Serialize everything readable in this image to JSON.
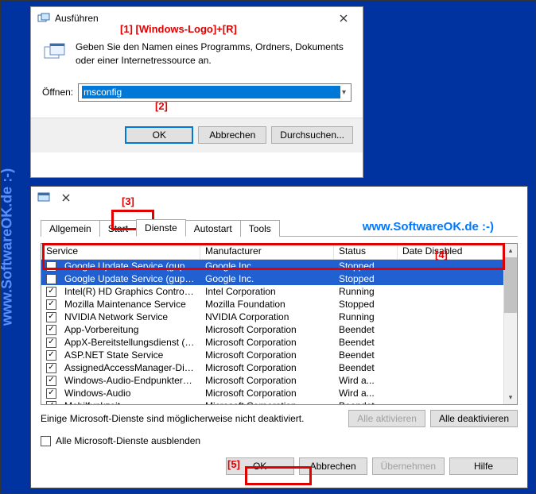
{
  "watermark_left": "www.SoftwareOK.de :-)",
  "annotations": {
    "a1": "[1]   [Windows-Logo]+[R]",
    "a2": "[2]",
    "a3": "[3]",
    "a4": "[4]",
    "a5": "[5]"
  },
  "run": {
    "title": "Ausführen",
    "description": "Geben Sie den Namen eines Programms, Ordners, Dokuments oder einer Internetressource an.",
    "open_label": "Öffnen:",
    "value": "msconfig",
    "ok": "OK",
    "cancel": "Abbrechen",
    "browse": "Durchsuchen..."
  },
  "msconfig": {
    "tabs": [
      "Allgemein",
      "Start",
      "Dienste",
      "Autostart",
      "Tools"
    ],
    "active_tab": 2,
    "watermark_tab": "www.SoftwareOK.de :-)",
    "columns": {
      "service": "Service",
      "manufacturer": "Manufacturer",
      "status": "Status",
      "date_disabled": "Date Disabled"
    },
    "rows": [
      {
        "checked": false,
        "selected": true,
        "service": "Google Update Service (gupdate)",
        "mfr": "Google Inc.",
        "status": "Stopped"
      },
      {
        "checked": false,
        "selected": true,
        "service": "Google Update Service (gupdatem)",
        "mfr": "Google Inc.",
        "status": "Stopped"
      },
      {
        "checked": true,
        "selected": false,
        "service": "Intel(R) HD Graphics Control Panel Se...",
        "mfr": "Intel Corporation",
        "status": "Running"
      },
      {
        "checked": true,
        "selected": false,
        "service": "Mozilla Maintenance Service",
        "mfr": "Mozilla Foundation",
        "status": "Stopped"
      },
      {
        "checked": true,
        "selected": false,
        "service": "NVIDIA Network Service",
        "mfr": "NVIDIA Corporation",
        "status": "Running"
      },
      {
        "checked": true,
        "selected": false,
        "service": "App-Vorbereitung",
        "mfr": "Microsoft Corporation",
        "status": "Beendet"
      },
      {
        "checked": true,
        "selected": false,
        "service": "AppX-Bereitstellungsdienst (App...",
        "mfr": "Microsoft Corporation",
        "status": "Beendet"
      },
      {
        "checked": true,
        "selected": false,
        "service": "ASP.NET State Service",
        "mfr": "Microsoft Corporation",
        "status": "Beendet"
      },
      {
        "checked": true,
        "selected": false,
        "service": "AssignedAccessManager-Dienst",
        "mfr": "Microsoft Corporation",
        "status": "Beendet"
      },
      {
        "checked": true,
        "selected": false,
        "service": "Windows-Audio-Endpunkterstell...",
        "mfr": "Microsoft Corporation",
        "status": "Wird a..."
      },
      {
        "checked": true,
        "selected": false,
        "service": "Windows-Audio",
        "mfr": "Microsoft Corporation",
        "status": "Wird a..."
      },
      {
        "checked": true,
        "selected": false,
        "service": "Mobilfunkzeit",
        "mfr": "Microsoft Corporation",
        "status": "Beendet"
      }
    ],
    "note": "Einige Microsoft-Dienste sind möglicherweise nicht deaktiviert.",
    "enable_all": "Alle aktivieren",
    "disable_all": "Alle deaktivieren",
    "hide_ms": "Alle Microsoft-Dienste ausblenden",
    "ok": "OK",
    "cancel": "Abbrechen",
    "apply": "Übernehmen",
    "help": "Hilfe"
  }
}
